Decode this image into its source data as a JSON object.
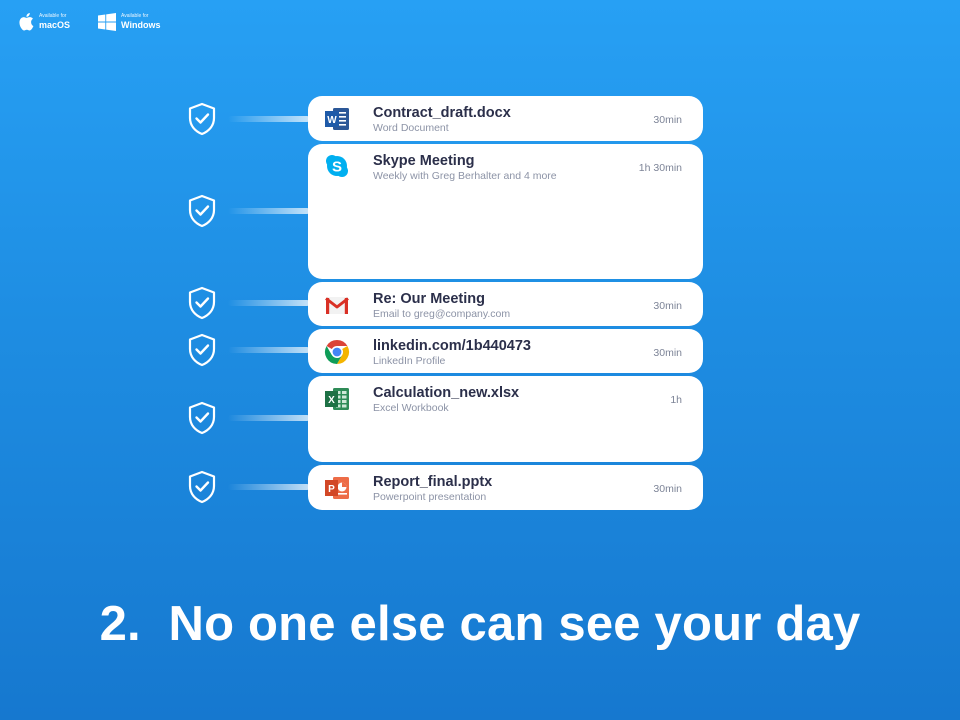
{
  "badges": [
    {
      "small": "Available for",
      "platform": "macOS",
      "icon": "apple-icon"
    },
    {
      "small": "Available for",
      "platform": "Windows",
      "icon": "windows-icon"
    }
  ],
  "items": [
    {
      "title": "Contract_draft.docx",
      "subtitle": "Word Document",
      "duration": "30min",
      "icon": "word-icon",
      "status_icon": "shield-check-icon"
    },
    {
      "title": "Skype Meeting",
      "subtitle": "Weekly with Greg Berhalter and 4 more",
      "duration": "1h 30min",
      "icon": "skype-icon",
      "status_icon": "shield-check-icon"
    },
    {
      "title": "Re: Our Meeting",
      "subtitle": "Email to greg@company.com",
      "duration": "30min",
      "icon": "gmail-icon",
      "status_icon": "shield-check-icon"
    },
    {
      "title": "linkedin.com/1b440473",
      "subtitle": "LinkedIn Profile",
      "duration": "30min",
      "icon": "chrome-icon",
      "status_icon": "shield-check-icon"
    },
    {
      "title": "Calculation_new.xlsx",
      "subtitle": "Excel Workbook",
      "duration": "1h",
      "icon": "excel-icon",
      "status_icon": "shield-check-icon"
    },
    {
      "title": "Report_final.pptx",
      "subtitle": "Powerpoint presentation",
      "duration": "30min",
      "icon": "powerpoint-icon",
      "status_icon": "shield-check-icon"
    }
  ],
  "headline": "2.  No one else can see your day",
  "colors": {
    "background_top": "#27a0f4",
    "background_bottom": "#1678cf",
    "card": "#ffffff",
    "title_text": "#2b2f4a"
  }
}
